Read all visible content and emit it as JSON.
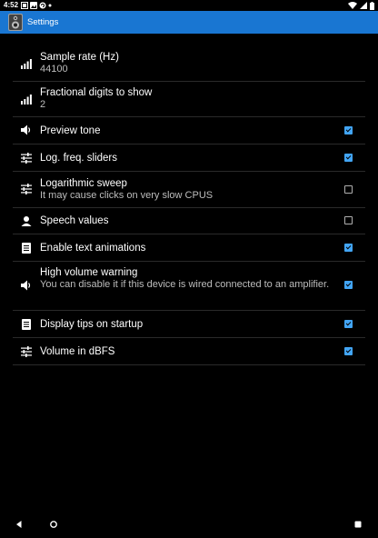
{
  "status_bar": {
    "time": "4:52",
    "icons": [
      "notification-icon",
      "photo-icon",
      "sync-icon",
      "dot-icon",
      "wifi-icon",
      "signal-icon",
      "battery-icon"
    ]
  },
  "app_bar": {
    "title": "Settings",
    "color": "#1976d2",
    "icon": "speaker-app-icon"
  },
  "settings": [
    {
      "key": "sample_rate",
      "icon": "signal-bars-icon",
      "title": "Sample rate (Hz)",
      "subtitle": "44100"
    },
    {
      "key": "fractional_digits",
      "icon": "signal-bars-icon",
      "title": "Fractional digits to show",
      "subtitle": "2"
    },
    {
      "key": "preview_tone",
      "icon": "speaker-icon",
      "title": "Preview tone",
      "checked": true
    },
    {
      "key": "log_freq_sliders",
      "icon": "sliders-icon",
      "title": "Log. freq. sliders",
      "checked": true
    },
    {
      "key": "log_sweep",
      "icon": "sliders-icon",
      "title": "Logarithmic sweep",
      "subtitle": "It may cause clicks on very slow CPUS",
      "checked": false
    },
    {
      "key": "speech_values",
      "icon": "person-icon",
      "title": "Speech values",
      "checked": false
    },
    {
      "key": "text_animations",
      "icon": "document-icon",
      "title": "Enable text animations",
      "checked": true
    },
    {
      "key": "high_volume",
      "icon": "speaker-icon",
      "title": "High volume warning",
      "subtitle": "You can disable it if this device is wired connected to an amplifier.",
      "checked": true
    },
    {
      "key": "tips_on_startup",
      "icon": "document-icon",
      "title": "Display tips on startup",
      "checked": true
    },
    {
      "key": "volume_dbfs",
      "icon": "sliders-icon",
      "title": "Volume in dBFS",
      "checked": true
    }
  ],
  "nav_bar": {
    "back": "back-icon",
    "home": "home-icon",
    "recents": "recents-icon"
  },
  "colors": {
    "accent": "#42a5f5",
    "background": "#000000",
    "divider": "#2a2a2a"
  }
}
